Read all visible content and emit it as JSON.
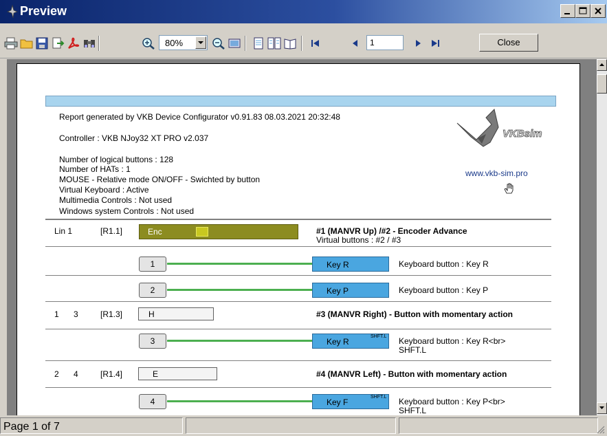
{
  "window": {
    "title": "Preview"
  },
  "toolbar": {
    "zoom_value": "80%",
    "page_value": "1",
    "close_label": "Close"
  },
  "report": {
    "generated": "Report generated by VKB Device Configurator v0.91.83  08.03.2021   20:32:48",
    "controller": "Controller : VKB NJoy32 XT PRO  v2.037",
    "info": [
      "Number of logical buttons : 128",
      "Number of HATs : 1",
      "MOUSE - Relative mode ON/OFF - Swichted by button",
      "Virtual Keyboard : Active",
      "Multimedia Controls : Not used",
      "Windows system Controls : Not used"
    ],
    "logo_text": "VKBsim",
    "website": "www.vkb-sim.pro"
  },
  "rows": [
    {
      "a": "Lin  1",
      "b": "",
      "c": "[R1.1]",
      "box": "Enc",
      "title": "#1 (MANVR Up)  /#2  - Encoder Advance",
      "subtitle": "Virtual buttons : #2 / #3"
    },
    {
      "num": "1",
      "key": "Key R",
      "shift": "",
      "desc": "Keyboard button : Key R"
    },
    {
      "num": "2",
      "key": "Key P",
      "shift": "",
      "desc": "Keyboard button : Key P"
    },
    {
      "a": "1",
      "b": "3",
      "c": "[R1.3]",
      "box": "H",
      "title": "#3 (MANVR Right) - Button with momentary action"
    },
    {
      "num": "3",
      "key": "Key R",
      "shift": "SHFT.L",
      "desc": "Keyboard button : Key R<br>",
      "desc2": "SHFT.L"
    },
    {
      "a": "2",
      "b": "4",
      "c": "[R1.4]",
      "box": "E",
      "title": "#4 (MANVR Left) - Button with momentary action"
    },
    {
      "num": "4",
      "key": "Key F",
      "shift": "SHFT.L",
      "desc": "Keyboard button : Key P<br>",
      "desc2": "SHFT.L"
    }
  ],
  "status": {
    "page": "Page 1 of 7"
  },
  "colors": {
    "title_start": "#0a246a",
    "accent_blue": "#4aa6e0",
    "encoder": "#8c8c20",
    "wire": "#4caf50"
  },
  "icons": [
    "print-icon",
    "open-folder-icon",
    "save-icon",
    "export-icon",
    "pdf-icon",
    "find-icon",
    "zoom-in-icon",
    "zoom-out-icon",
    "fit-page-icon",
    "single-page-icon",
    "two-page-icon",
    "book-icon",
    "first-page-icon",
    "prev-page-icon",
    "next-page-icon",
    "last-page-icon"
  ]
}
